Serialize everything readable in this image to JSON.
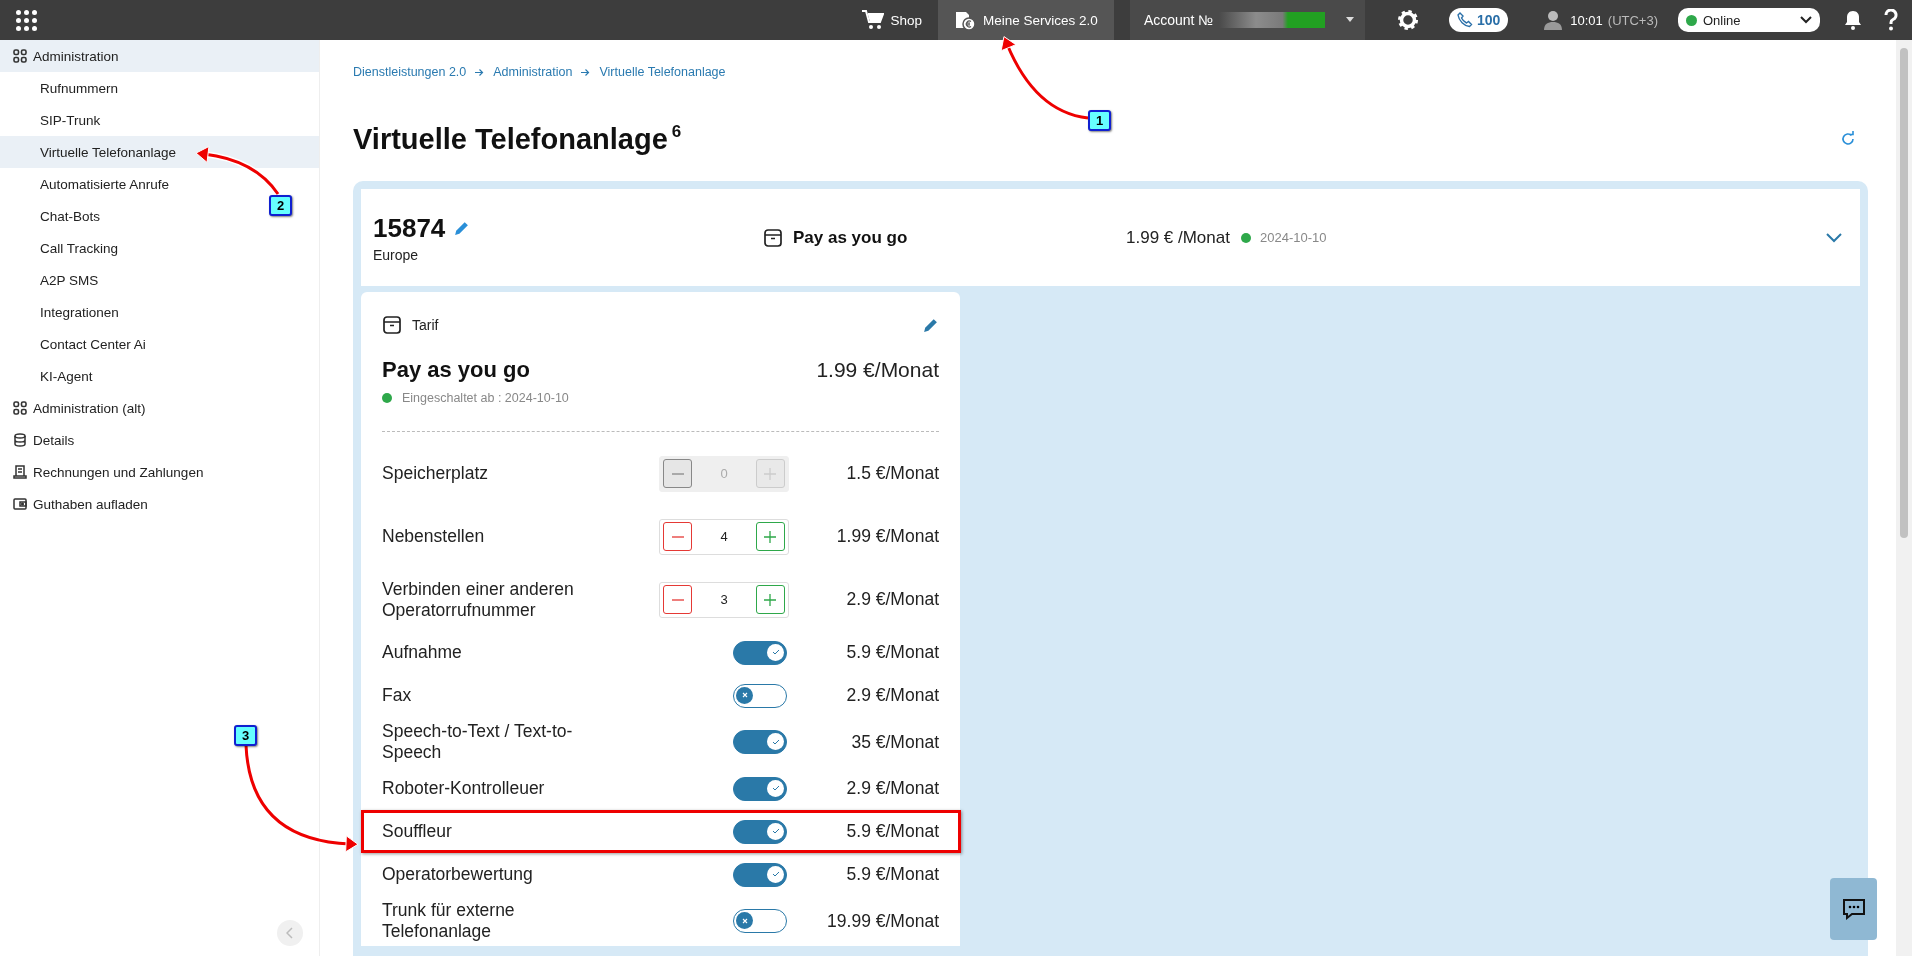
{
  "topbar": {
    "nav": [
      {
        "label": "Shop",
        "selected": false
      },
      {
        "label": "Meine Services 2.0",
        "selected": true
      }
    ],
    "account": {
      "label": "Account №"
    },
    "calls": "100",
    "time": "10:01",
    "timezone": "(UTC+3)",
    "status": "Online"
  },
  "sidebar": {
    "groups": [
      {
        "label": "Administration",
        "expanded": true,
        "children": [
          {
            "label": "Rufnummern",
            "selected": false
          },
          {
            "label": "SIP-Trunk",
            "selected": false
          },
          {
            "label": "Virtuelle Telefonanlage",
            "selected": true
          },
          {
            "label": "Automatisierte Anrufe",
            "selected": false
          },
          {
            "label": "Chat-Bots",
            "selected": false
          },
          {
            "label": "Call Tracking",
            "selected": false
          },
          {
            "label": "A2P SMS",
            "selected": false
          },
          {
            "label": "Integrationen",
            "selected": false
          },
          {
            "label": "Contact Center Ai",
            "selected": false
          },
          {
            "label": "KI-Agent",
            "selected": false
          }
        ]
      },
      {
        "label": "Administration (alt)",
        "expanded": false
      },
      {
        "label": "Details",
        "expanded": false
      },
      {
        "label": "Rechnungen und Zahlungen",
        "expanded": false
      },
      {
        "label": "Guthaben aufladen",
        "expanded": false
      }
    ]
  },
  "breadcrumb": [
    "Dienstleistungen 2.0",
    "Administration",
    "Virtuelle Telefonanlage"
  ],
  "page": {
    "title": "Virtuelle Telefonanlage",
    "count": "6"
  },
  "service": {
    "number": "15874",
    "region": "Europe",
    "plan": "Pay as you go",
    "price": "1.99 € /Monat",
    "date": "2024-10-10"
  },
  "tariff": {
    "label": "Tarif",
    "name": "Pay as you go",
    "price": "1.99 €/Monat",
    "active_since": "Eingeschaltet ab : 2024-10-10",
    "options": [
      {
        "kind": "stepper",
        "label": "Speicherplatz",
        "value": "0",
        "disabled": true,
        "price": "1.5 €/Monat"
      },
      {
        "kind": "stepper",
        "label": "Nebenstellen",
        "value": "4",
        "disabled": false,
        "price": "1.99 €/Monat"
      },
      {
        "kind": "stepper",
        "label": "Verbinden einer anderen Operatorrufnummer",
        "value": "3",
        "disabled": false,
        "price": "2.9 €/Monat"
      },
      {
        "kind": "toggle",
        "label": "Aufnahme",
        "on": true,
        "price": "5.9 €/Monat"
      },
      {
        "kind": "toggle",
        "label": "Fax",
        "on": false,
        "price": "2.9 €/Monat"
      },
      {
        "kind": "toggle",
        "label": "Speech-to-Text / Text-to-Speech",
        "on": true,
        "price": "35 €/Monat"
      },
      {
        "kind": "toggle",
        "label": "Roboter-Kontrolleuer",
        "on": true,
        "price": "2.9 €/Monat"
      },
      {
        "kind": "toggle",
        "label": "Souffleur",
        "on": true,
        "price": "5.9 €/Monat"
      },
      {
        "kind": "toggle",
        "label": "Operatorbewertung",
        "on": true,
        "price": "5.9 €/Monat"
      },
      {
        "kind": "toggle",
        "label": "Trunk für externe Telefonanlage",
        "on": false,
        "price": "19.99 €/Monat"
      }
    ]
  },
  "annotations": {
    "callouts": [
      "1",
      "2",
      "3"
    ],
    "highlight": true
  }
}
